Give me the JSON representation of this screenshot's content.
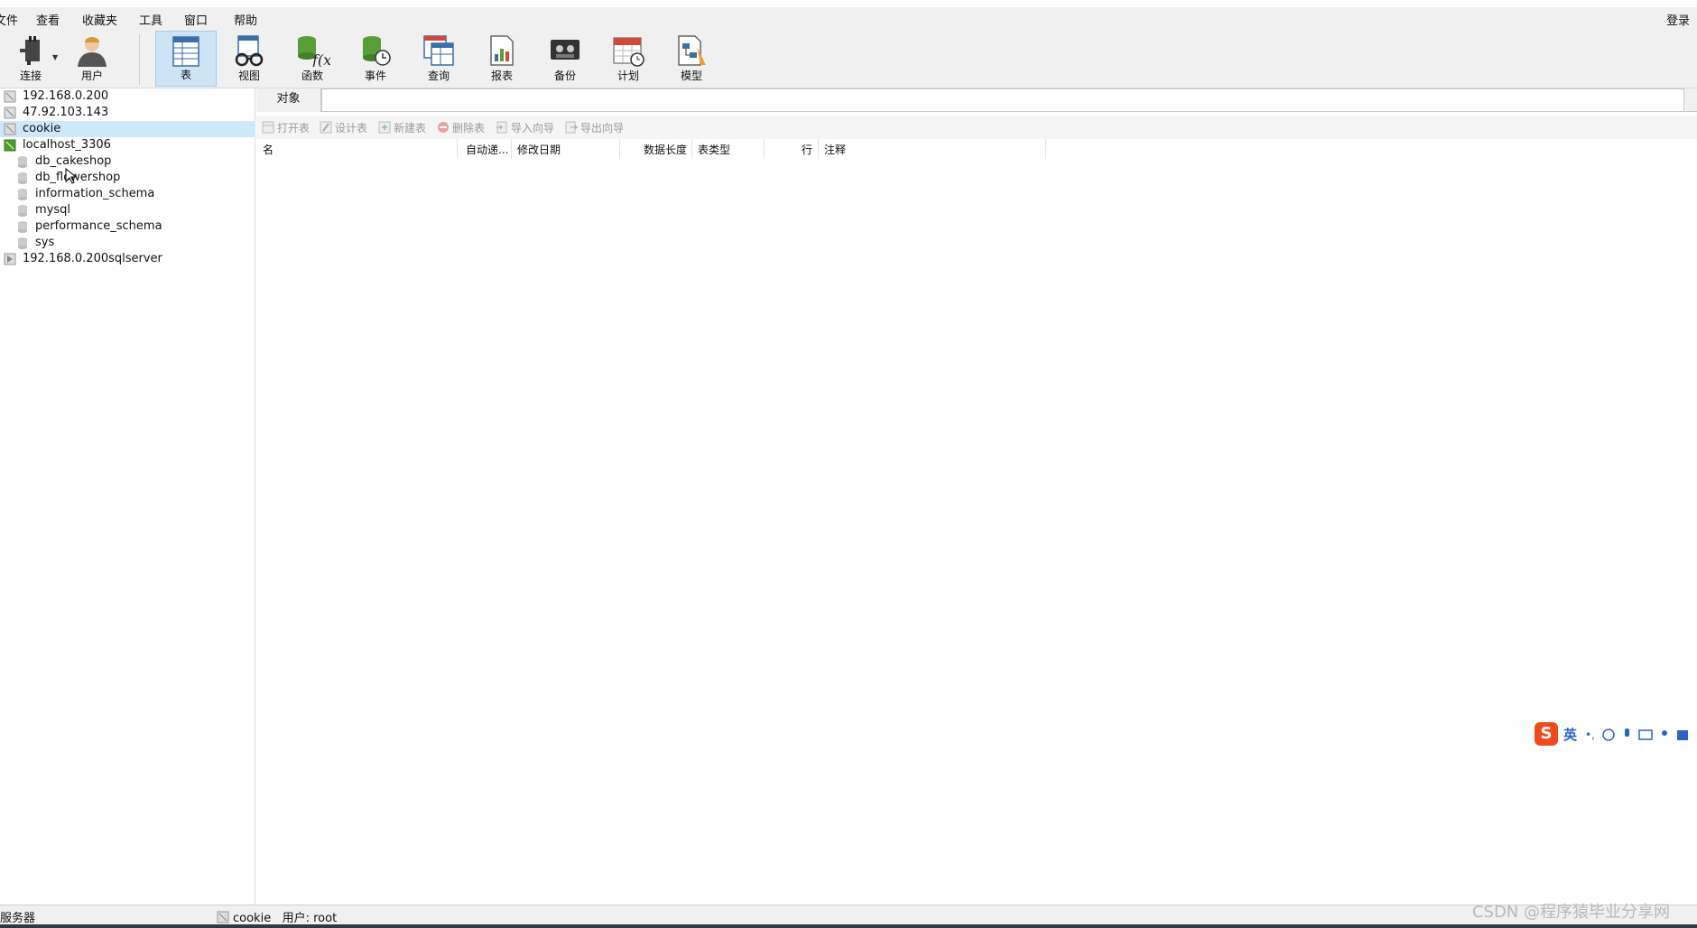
{
  "menubar": {
    "items": [
      "文件",
      "查看",
      "收藏夹",
      "工具",
      "窗口",
      "帮助"
    ],
    "login": "登录"
  },
  "toolbar": {
    "tools": [
      {
        "label": "连接",
        "icon": "plug-connect-icon"
      },
      {
        "label": "用户",
        "icon": "user-icon"
      },
      {
        "label": "表",
        "icon": "table-icon"
      },
      {
        "label": "视图",
        "icon": "glasses-view-icon"
      },
      {
        "label": "函数",
        "icon": "function-fx-icon"
      },
      {
        "label": "事件",
        "icon": "event-clock-icon"
      },
      {
        "label": "查询",
        "icon": "query-table-icon"
      },
      {
        "label": "报表",
        "icon": "report-chart-icon"
      },
      {
        "label": "备份",
        "icon": "backup-tape-icon"
      },
      {
        "label": "计划",
        "icon": "calendar-schedule-icon"
      },
      {
        "label": "模型",
        "icon": "model-diagram-icon"
      }
    ],
    "active": "表"
  },
  "tree": {
    "items": [
      {
        "label": "192.168.0.200",
        "level": 0,
        "type": "connection"
      },
      {
        "label": "47.92.103.143",
        "level": 0,
        "type": "connection"
      },
      {
        "label": "cookie",
        "level": 0,
        "type": "connection",
        "selected": true
      },
      {
        "label": "localhost_3306",
        "level": 0,
        "type": "connection-open"
      },
      {
        "label": "db_cakeshop",
        "level": 1,
        "type": "database"
      },
      {
        "label": "db_flowershop",
        "level": 1,
        "type": "database"
      },
      {
        "label": "information_schema",
        "level": 1,
        "type": "database"
      },
      {
        "label": "mysql",
        "level": 1,
        "type": "database"
      },
      {
        "label": "performance_schema",
        "level": 1,
        "type": "database"
      },
      {
        "label": "sys",
        "level": 1,
        "type": "database"
      },
      {
        "label": "192.168.0.200sqlserver",
        "level": 0,
        "type": "connection-sqlserver"
      }
    ]
  },
  "objects": {
    "tab_label": "对象",
    "tools": [
      "打开表",
      "设计表",
      "新建表",
      "删除表",
      "导入向导",
      "导出向导"
    ],
    "columns": [
      "名",
      "自动递...",
      "修改日期",
      "数据长度",
      "表类型",
      "行",
      "注释"
    ]
  },
  "ime": {
    "logo": "S",
    "mode": "英"
  },
  "statusbar": {
    "left": "服务器",
    "connection": "cookie",
    "user": "用户: root"
  },
  "watermark": "CSDN @程序猿毕业分享网"
}
